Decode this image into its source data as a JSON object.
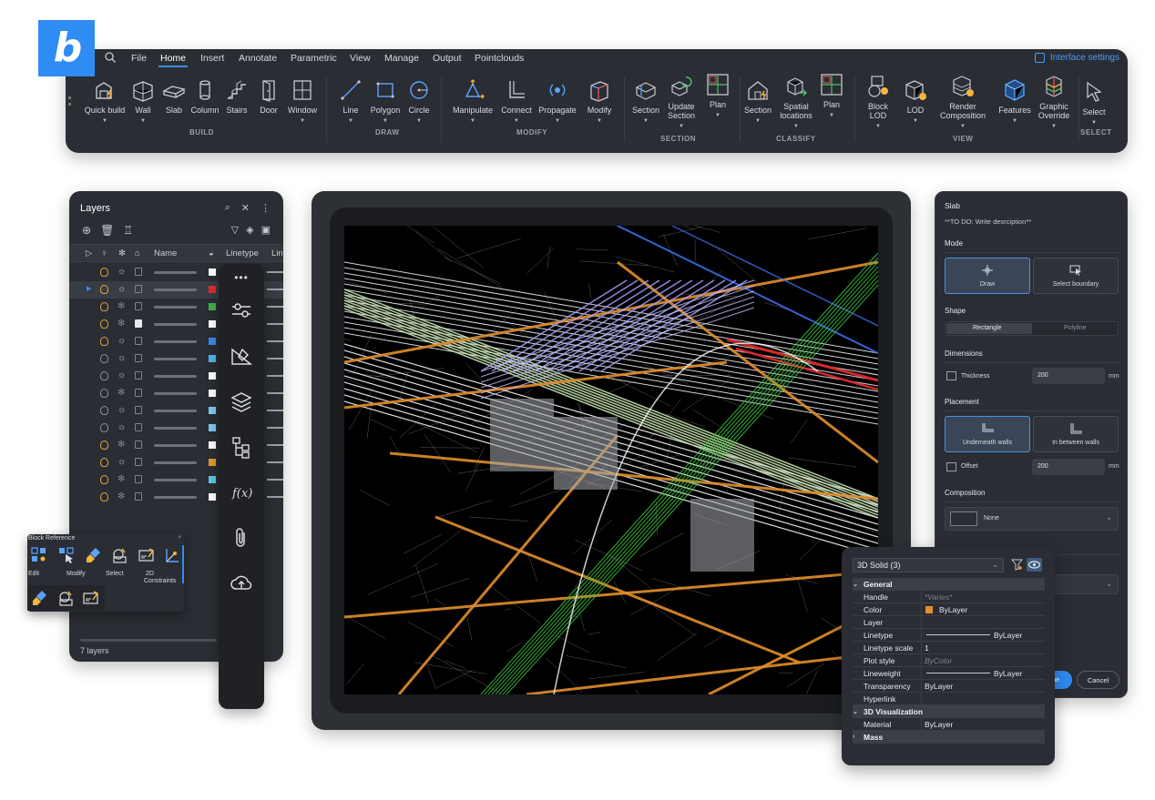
{
  "ribbon": {
    "menu": [
      "File",
      "Home",
      "Insert",
      "Annotate",
      "Parametric",
      "View",
      "Manage",
      "Output",
      "Pointclouds"
    ],
    "active_menu": "Home",
    "interface_settings": "Interface settings",
    "groups": {
      "build": "BUILD",
      "draw": "DRAW",
      "modify": "MODIFY",
      "section": "SECTION",
      "classify": "CLASSIFY",
      "view": "VIEW",
      "select": "SELECT"
    },
    "buttons": {
      "quick_build": "Quick build",
      "wall": "Wall",
      "slab": "Slab",
      "column": "Column",
      "stairs": "Stairs",
      "door": "Door",
      "window": "Window",
      "line": "Line",
      "polygon": "Polygon",
      "circle": "Circle",
      "manipulate": "Manipulate",
      "connect": "Connect",
      "propagate": "Propagate",
      "modify": "Modify",
      "section": "Section",
      "update_section_1": "Update",
      "update_section_2": "Section",
      "plan": "Plan",
      "section2": "Section",
      "spatial_locations_1": "Spatial",
      "spatial_locations_2": "locations",
      "plan2": "Plan",
      "block_lod_1": "Block",
      "block_lod_2": "LOD",
      "lod": "LOD",
      "render_composition_1": "Render",
      "render_composition_2": "Composition",
      "features": "Features",
      "graphic_override_1": "Graphic",
      "graphic_override_2": "Override",
      "select": "Select"
    }
  },
  "layers": {
    "title": "Layers",
    "columns": {
      "name": "Name",
      "linetype": "Linetype",
      "lineweight": "Lin"
    },
    "footer": "7 layers",
    "rows": [
      {
        "on": true,
        "frozen": false,
        "locked": false,
        "color": "#ffffff",
        "selected": false
      },
      {
        "on": true,
        "frozen": false,
        "locked": false,
        "color": "#e02b2b",
        "selected": true
      },
      {
        "on": true,
        "frozen": true,
        "locked": false,
        "color": "#3fb24b",
        "selected": false
      },
      {
        "on": true,
        "frozen": true,
        "locked": true,
        "color": "#ffffff",
        "selected": false
      },
      {
        "on": true,
        "frozen": false,
        "locked": false,
        "color": "#3a86e8",
        "selected": false
      },
      {
        "on": false,
        "frozen": false,
        "locked": false,
        "color": "#4fb5e6",
        "selected": false
      },
      {
        "on": false,
        "frozen": false,
        "locked": false,
        "color": "#ffffff",
        "selected": false
      },
      {
        "on": false,
        "frozen": true,
        "locked": false,
        "color": "#ffffff",
        "selected": false
      },
      {
        "on": false,
        "frozen": false,
        "locked": false,
        "color": "#7fc8ee",
        "selected": false
      },
      {
        "on": false,
        "frozen": false,
        "locked": false,
        "color": "#7fc8ee",
        "selected": false
      },
      {
        "on": true,
        "frozen": true,
        "locked": false,
        "color": "#ffffff",
        "selected": false
      },
      {
        "on": true,
        "frozen": false,
        "locked": false,
        "color": "#e3992c",
        "selected": false
      },
      {
        "on": true,
        "frozen": true,
        "locked": false,
        "color": "#59c9e8",
        "selected": false
      },
      {
        "on": true,
        "frozen": true,
        "locked": false,
        "color": "#ffffff",
        "selected": false
      }
    ]
  },
  "block_reference": {
    "title": "Block Reference",
    "edit": "Edit",
    "modify": "Modify",
    "select": "Select",
    "constraints_1": "2D",
    "constraints_2": "Constraints"
  },
  "slab": {
    "title": "Slab",
    "description": "**TO DO: Write desrciption**",
    "mode": "Mode",
    "draw": "Draw",
    "select_boundary": "Select boundary",
    "shape": "Shape",
    "rectangle": "Rectangle",
    "polyline": "Polyline",
    "dimensions": "Dimensions",
    "thickness_label": "Thickness",
    "thickness_value": "200",
    "unit": "mm",
    "placement": "Placement",
    "underneath_walls": "Underneath walls",
    "in_between_walls": "In between walls",
    "offset_label": "Offset",
    "offset_value": "200",
    "composition": "Composition",
    "composition_value": "None",
    "done": "ne",
    "cancel": "Cancel"
  },
  "properties": {
    "selection": "3D Solid (3)",
    "general": "General",
    "rows": [
      {
        "key": "Handle",
        "value": "*Varies*",
        "placeholder": true
      },
      {
        "key": "Color",
        "value": "ByLayer",
        "swatch": "#e38e2c"
      },
      {
        "key": "Layer",
        "value": ""
      },
      {
        "key": "Linetype",
        "value": "ByLayer",
        "line": true
      },
      {
        "key": "Linetype scale",
        "value": "1"
      },
      {
        "key": "Plot style",
        "value": "ByColor",
        "placeholder": true
      },
      {
        "key": "Lineweight",
        "value": "ByLayer",
        "line": true
      },
      {
        "key": "Transparency",
        "value": "ByLayer"
      },
      {
        "key": "Hyperlink",
        "value": ""
      }
    ],
    "viz": "3D Visualization",
    "material_key": "Material",
    "material_value": "ByLayer",
    "mass": "Mass"
  },
  "colors": {
    "accent": "#2f8cf2",
    "panel": "#2a2d33",
    "orange": "#e38e2c"
  }
}
